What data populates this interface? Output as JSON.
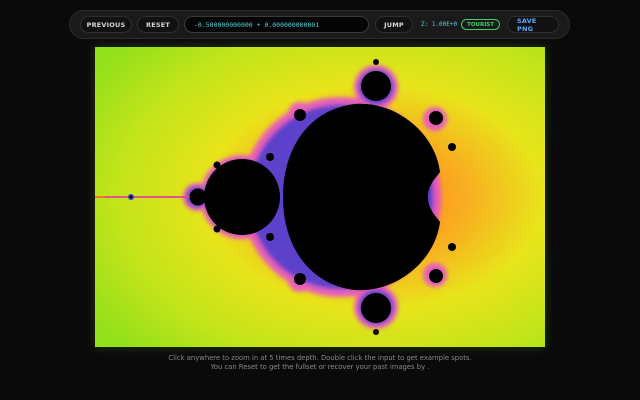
{
  "toolbar": {
    "previous_label": "PREVIOUS",
    "reset_label": "RESET",
    "coordinate_value": "-0.500000000000 + 0.000000000001",
    "jump_label": "JUMP",
    "zoom_text": "Z: 1.00E+0",
    "mode_badge": "TOURIST",
    "save_label": "SAVE PNG"
  },
  "footer": {
    "line1": "Click anywhere to zoom in at 5 times depth. Double click the input to get example spots.",
    "line2": "You can Reset to get the fullset or recover your past images by ."
  },
  "colors": {
    "background": "#0a0a0a",
    "accent_cyan": "#4fd6e0",
    "badge_green": "#3fd06a",
    "save_blue": "#5aa8ff",
    "set_interior": "#000000",
    "outer_green": "#9be21a",
    "yellow": "#e8e61a",
    "orange": "#ff9a20",
    "magenta": "#e64bd6",
    "blue": "#3b3bd0"
  },
  "fractal": {
    "type": "mandelbrot",
    "center_re": -0.5,
    "center_im": 0.0,
    "zoom": 1
  }
}
